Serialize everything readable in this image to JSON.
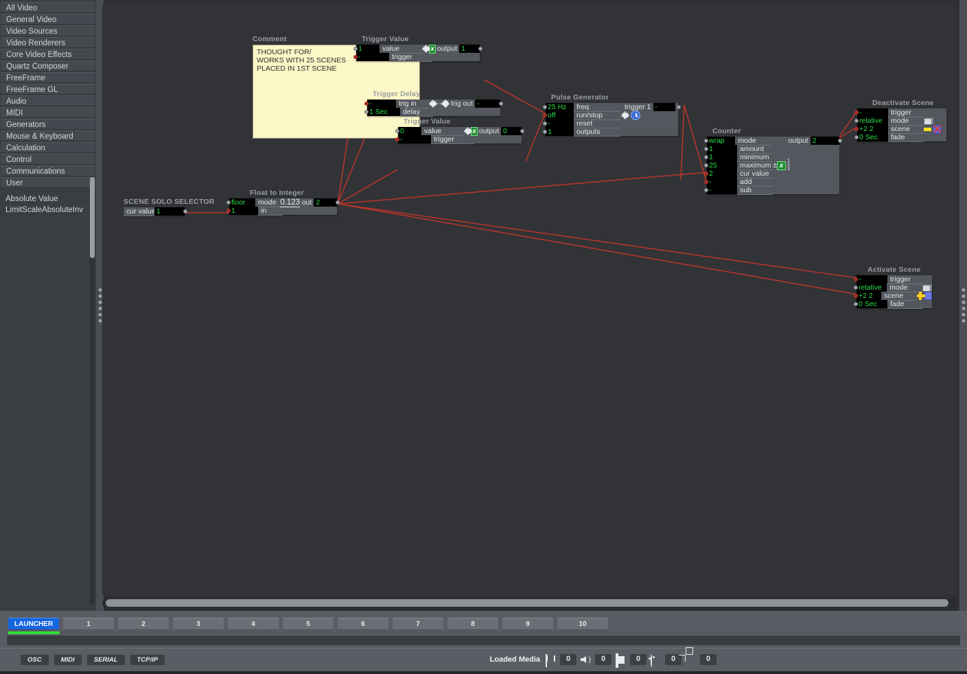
{
  "sidebar": {
    "categories": [
      {
        "label": "All Video"
      },
      {
        "label": "General Video"
      },
      {
        "label": "Video Sources"
      },
      {
        "label": "Video Renderers"
      },
      {
        "label": "Core Video Effects"
      },
      {
        "label": "Quartz Composer"
      },
      {
        "label": "FreeFrame"
      },
      {
        "label": "FreeFrame GL"
      },
      {
        "label": "Audio"
      },
      {
        "label": "MIDI"
      },
      {
        "label": "Generators"
      },
      {
        "label": "Mouse & Keyboard"
      },
      {
        "label": "Calculation"
      },
      {
        "label": "Control"
      },
      {
        "label": "Communications"
      },
      {
        "label": "User"
      }
    ],
    "objects": [
      {
        "label": "Absolute Value"
      },
      {
        "label": "LimitScaleAbsoluteInv"
      }
    ]
  },
  "comment": {
    "title": "Comment",
    "text": "THOUGHT FOR/\nWORKS WITH 25 SCENES\nPLACED IN 1ST SCENE"
  },
  "nodes": {
    "trigger_value_1": {
      "title": "Trigger Value",
      "rows": [
        {
          "value": "1",
          "label": "value"
        },
        {
          "value": "-",
          "label": "trigger"
        }
      ],
      "out_label": "output",
      "out_value": "1"
    },
    "trigger_delay": {
      "title": "Trigger Delay",
      "rows": [
        {
          "value": "-",
          "label": "trig in"
        },
        {
          "value": "1 Sec",
          "label": "delay"
        }
      ],
      "out_label": "trig out",
      "out_value": "-"
    },
    "trigger_value_2": {
      "title": "Trigger Value",
      "rows": [
        {
          "value": "0",
          "label": "value"
        },
        {
          "value": "-",
          "label": "trigger"
        }
      ],
      "out_label": "output",
      "out_value": "0"
    },
    "pulse_generator": {
      "title": "Pulse Generator",
      "rows": [
        {
          "value": "25 Hz",
          "label": "freq"
        },
        {
          "value": "off",
          "label": "run/stop"
        },
        {
          "value": "-",
          "label": "reset"
        },
        {
          "value": "1",
          "label": "outputs"
        }
      ],
      "out_label": "trigger 1",
      "out_value": "-"
    },
    "counter": {
      "title": "Counter",
      "rows": [
        {
          "value": "wrap",
          "label": "mode"
        },
        {
          "value": "1",
          "label": "amount"
        },
        {
          "value": "1",
          "label": "minimum"
        },
        {
          "value": "25",
          "label": "maximum"
        },
        {
          "value": "2",
          "label": "cur value"
        },
        {
          "value": "-",
          "label": "add"
        },
        {
          "value": "-",
          "label": "sub"
        }
      ],
      "out_label": "output",
      "out_value": "2"
    },
    "deactivate_scene": {
      "title": "Deactivate Scene",
      "rows": [
        {
          "value": "-",
          "label": "trigger"
        },
        {
          "value": "relative",
          "label": "mode"
        },
        {
          "value": "+2 2",
          "label": "scene"
        },
        {
          "value": "0 Sec",
          "label": "fade"
        }
      ]
    },
    "activate_scene": {
      "title": "Activate Scene",
      "rows": [
        {
          "value": "-",
          "label": "trigger"
        },
        {
          "value": "relative",
          "label": "mode"
        },
        {
          "value": "+2 2",
          "label": "scene"
        },
        {
          "value": "0 Sec",
          "label": "fade"
        }
      ]
    },
    "scene_solo_selector": {
      "title": "SCENE SOLO SELECTOR",
      "rows": [
        {
          "value": "1",
          "label": "cur value"
        }
      ]
    },
    "float_to_integer": {
      "title": "Float to Integer",
      "rows": [
        {
          "value": "floor",
          "label": "mode"
        },
        {
          "value": "1",
          "label": "in"
        }
      ],
      "out_label": "out",
      "out_value": "2",
      "mode_icon_label": "0.123"
    }
  },
  "launcher": {
    "buttons": [
      {
        "label": "LAUNCHER",
        "active": true
      },
      {
        "label": "1",
        "active": false
      },
      {
        "label": "2",
        "active": false
      },
      {
        "label": "3",
        "active": false
      },
      {
        "label": "4",
        "active": false
      },
      {
        "label": "5",
        "active": false
      },
      {
        "label": "6",
        "active": false
      },
      {
        "label": "7",
        "active": false
      },
      {
        "label": "8",
        "active": false
      },
      {
        "label": "9",
        "active": false
      },
      {
        "label": "10",
        "active": false
      }
    ]
  },
  "statusbar": {
    "protocols": [
      {
        "label": "OSC"
      },
      {
        "label": "MIDI"
      },
      {
        "label": "SERIAL"
      },
      {
        "label": "TCP/IP"
      }
    ],
    "loaded_media_label": "Loaded Media",
    "media_counts": [
      {
        "icon": "film-icon",
        "count": "0"
      },
      {
        "icon": "speaker-icon",
        "count": "0"
      },
      {
        "icon": "image-icon",
        "count": "0"
      },
      {
        "icon": "palette-icon",
        "count": "0"
      },
      {
        "icon": "cube-icon",
        "count": "0"
      }
    ]
  },
  "colors": {
    "accent_blue": "#1565e0",
    "wire_red": "#b5342b",
    "field_green": "#2ee04a",
    "comment_yellow": "#fbf7c6"
  }
}
